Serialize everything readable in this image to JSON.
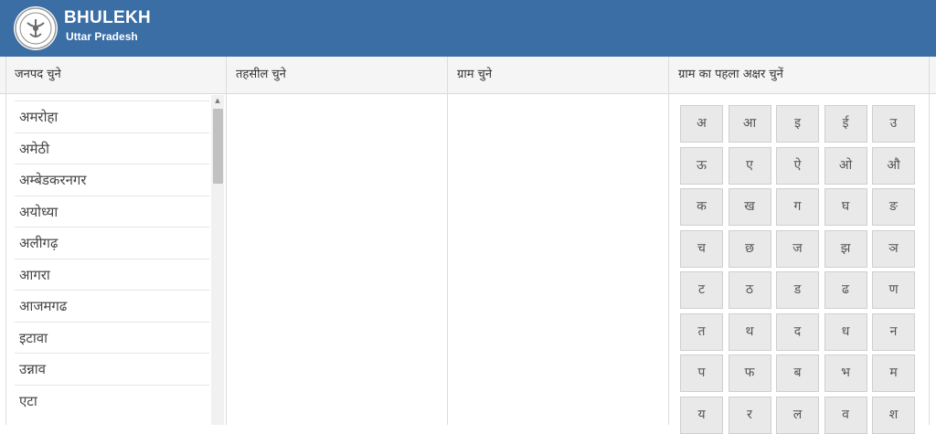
{
  "header": {
    "title": "BHULEKH",
    "subtitle": "Uttar Pradesh",
    "brand_color": "#3a6ea5",
    "logo_icon": "up-govt-emblem-icon"
  },
  "columns": [
    {
      "label": "जनपद चुने"
    },
    {
      "label": "तहसील चुने"
    },
    {
      "label": "ग्राम चुने"
    },
    {
      "label": "ग्राम का पहला अक्षर चुनें"
    }
  ],
  "districts": [
    "अमरोहा",
    "अमेठी",
    "अम्बेडकरनगर",
    "अयोध्या",
    "अलीगढ़",
    "आगरा",
    "आजमगढ",
    "इटावा",
    "उन्नाव",
    "एटा"
  ],
  "letters": [
    [
      "अ",
      "आ",
      "इ",
      "ई",
      "उ"
    ],
    [
      "ऊ",
      "ए",
      "ऐ",
      "ओ",
      "औ"
    ],
    [
      "क",
      "ख",
      "ग",
      "घ",
      "ङ"
    ],
    [
      "च",
      "छ",
      "ज",
      "झ",
      "ञ"
    ],
    [
      "ट",
      "ठ",
      "ड",
      "ढ",
      "ण"
    ],
    [
      "त",
      "थ",
      "द",
      "ध",
      "न"
    ],
    [
      "प",
      "फ",
      "ब",
      "भ",
      "म"
    ],
    [
      "य",
      "र",
      "ल",
      "व",
      "श"
    ]
  ]
}
